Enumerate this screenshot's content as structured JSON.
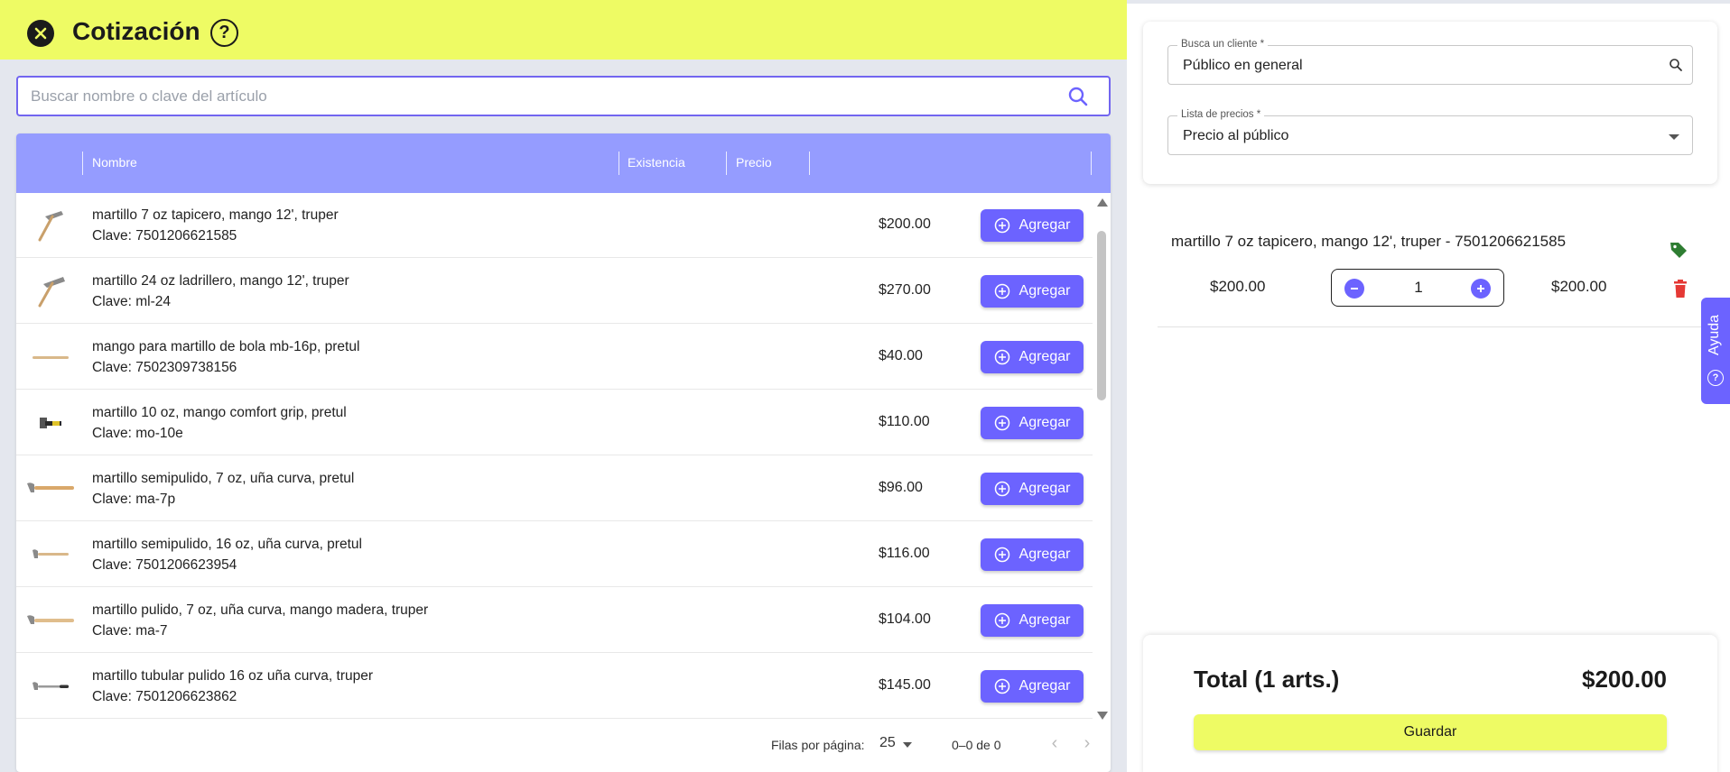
{
  "header": {
    "title": "Cotización",
    "help_glyph": "?"
  },
  "search": {
    "placeholder": "Buscar nombre o clave del artículo",
    "value": ""
  },
  "table": {
    "columns": [
      "Nombre",
      "Existencia",
      "Precio"
    ],
    "add_label": "Agregar",
    "rows": [
      {
        "name": "martillo 7 oz tapicero, mango 12', truper",
        "code": "Clave: 7501206621585",
        "price": "$200.00",
        "thumb": "hammer-pick-icon"
      },
      {
        "name": "martillo 24 oz ladrillero, mango 12', truper",
        "code": "Clave: ml-24",
        "price": "$270.00",
        "thumb": "hammer-pick-icon"
      },
      {
        "name": "mango para martillo de bola mb-16p, pretul",
        "code": "Clave: 7502309738156",
        "price": "$40.00",
        "thumb": "handle-icon"
      },
      {
        "name": "martillo 10 oz, mango comfort grip, pretul",
        "code": "Clave: mo-10e",
        "price": "$110.00",
        "thumb": "hammer-small-icon"
      },
      {
        "name": "martillo semipulido, 7 oz, uña curva, pretul",
        "code": "Clave: ma-7p",
        "price": "$96.00",
        "thumb": "claw-hammer-icon"
      },
      {
        "name": "martillo semipulido, 16 oz, uña curva, pretul",
        "code": "Clave: 7501206623954",
        "price": "$116.00",
        "thumb": "claw-hammer-icon"
      },
      {
        "name": "martillo pulido, 7 oz, uña curva, mango madera, truper",
        "code": "Clave: ma-7",
        "price": "$104.00",
        "thumb": "claw-hammer-icon"
      },
      {
        "name": "martillo tubular pulido 16 oz uña curva, truper",
        "code": "Clave: 7501206623862",
        "price": "$145.00",
        "thumb": "tubular-hammer-icon"
      }
    ]
  },
  "pagination": {
    "rows_per_page_label": "Filas por página:",
    "rows_per_page": "25",
    "range": "0–0 de 0"
  },
  "client": {
    "label": "Busca un cliente *",
    "value": "Público en general"
  },
  "price_list": {
    "label": "Lista de precios *",
    "value": "Precio al público"
  },
  "cart": {
    "items": [
      {
        "title": "martillo 7 oz tapicero, mango 12', truper - 7501206621585",
        "unit_price": "$200.00",
        "quantity": "1",
        "line_total": "$200.00"
      }
    ]
  },
  "help_tab": {
    "label": "Ayuda",
    "glyph": "?"
  },
  "summary": {
    "total_label": "Total (1 arts.)",
    "total_value": "$200.00",
    "save_label": "Guardar"
  },
  "colors": {
    "accent": "#6c63ff",
    "header_bg": "#eefb64",
    "table_header": "#959cff",
    "tag": "#2e7d32",
    "trash": "#e53935"
  }
}
